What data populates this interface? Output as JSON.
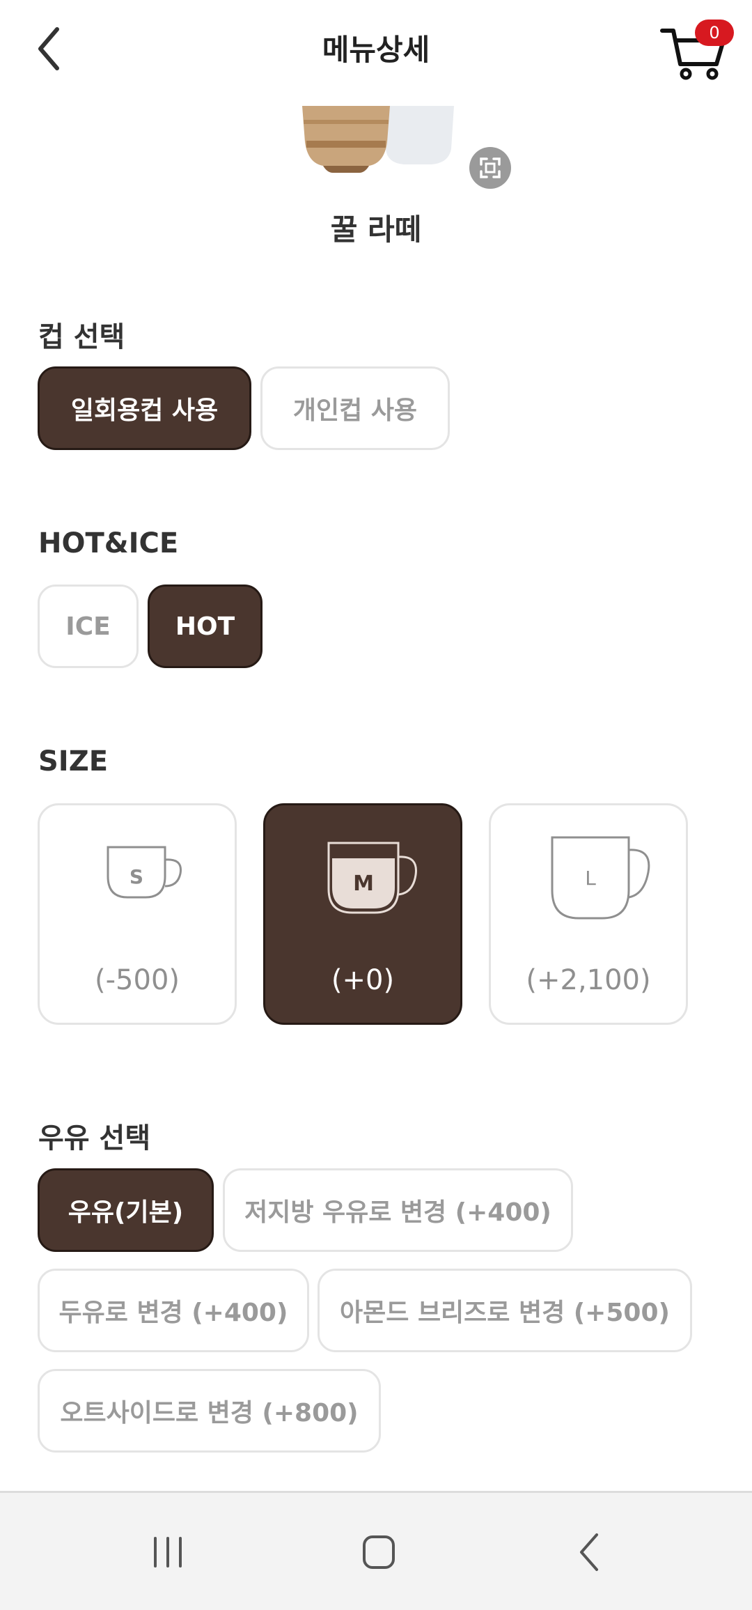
{
  "header": {
    "title": "메뉴상세",
    "back_icon": "chevron-left-icon",
    "cart_icon": "cart-icon",
    "cart_count": "0",
    "badge_color": "#d71920"
  },
  "product": {
    "name": "꿀 라떼",
    "zoom_icon": "expand-icon"
  },
  "cup": {
    "title": "컵 선택",
    "options": [
      "일회용컵 사용",
      "개인컵 사용"
    ],
    "selected": "일회용컵 사용"
  },
  "temp": {
    "title": "HOT&ICE",
    "options": [
      "ICE",
      "HOT"
    ],
    "selected": "HOT"
  },
  "size": {
    "title": "SIZE",
    "options": [
      {
        "letter": "S",
        "price": "(-500)"
      },
      {
        "letter": "M",
        "price": "(+0)"
      },
      {
        "letter": "L",
        "price": "(+2,100)"
      }
    ],
    "selected": "M"
  },
  "milk": {
    "title": "우유 선택",
    "options": [
      "우유(기본)",
      "저지방 우유로 변경 (+400)",
      "두유로 변경 (+400)",
      "아몬드 브리즈로 변경 (+500)",
      "오트사이드로 변경 (+800)"
    ],
    "selected": "우유(기본)"
  },
  "colors": {
    "selected_bg": "#4a362e",
    "unselected_text": "#9a9a9a"
  },
  "navbar": {
    "icons": [
      "recent-apps-icon",
      "home-icon",
      "back-icon"
    ]
  }
}
